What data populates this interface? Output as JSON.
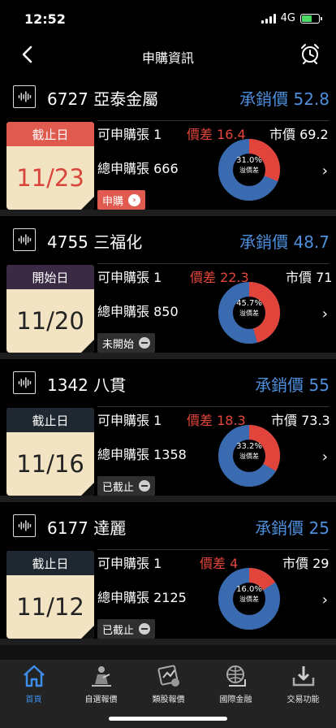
{
  "status_bar": {
    "time": "12:52",
    "network": "4G"
  },
  "nav": {
    "title": "申購資訊"
  },
  "listings": [
    {
      "name": "6727 亞泰金屬",
      "price_label": "承銷價 52.8",
      "calendar_label": "截止日",
      "date": "11/23",
      "calendar_style": "red",
      "lots": "可申購張 1",
      "spread": "價差 16.4",
      "market": "市價 69.2",
      "total": "總申購張 666",
      "status": "申購",
      "status_style": "apply",
      "donut_pct": "31.0%",
      "donut_sub": "溢價差",
      "donut_value": 0.31
    },
    {
      "name": "4755 三福化",
      "price_label": "承銷價 48.7",
      "calendar_label": "開始日",
      "date": "11/20",
      "calendar_style": "purple",
      "lots": "可申購張 1",
      "spread": "價差 22.3",
      "market": "市價 71",
      "total": "總申購張 850",
      "status": "未開始",
      "status_style": "muted",
      "donut_pct": "45.7%",
      "donut_sub": "溢價差",
      "donut_value": 0.457
    },
    {
      "name": "1342 八貫",
      "price_label": "承銷價 55",
      "calendar_label": "截止日",
      "date": "11/16",
      "calendar_style": "dark",
      "lots": "可申購張 1",
      "spread": "價差 18.3",
      "market": "市價 73.3",
      "total": "總申購張 1358",
      "status": "已截止",
      "status_style": "muted",
      "donut_pct": "33.2%",
      "donut_sub": "溢價差",
      "donut_value": 0.332
    },
    {
      "name": "6177 達麗",
      "price_label": "承銷價 25",
      "calendar_label": "截止日",
      "date": "11/12",
      "calendar_style": "dark",
      "lots": "可申購張 1",
      "spread": "價差 4",
      "market": "市價 29",
      "total": "總申購張 2125",
      "status": "已截止",
      "status_style": "muted",
      "donut_pct": "16.0%",
      "donut_sub": "溢價差",
      "donut_value": 0.16
    }
  ],
  "tabs": [
    {
      "label": "首頁",
      "icon": "home-icon",
      "active": true
    },
    {
      "label": "自選報價",
      "icon": "watchlist-icon",
      "active": false
    },
    {
      "label": "類股報價",
      "icon": "sector-icon",
      "active": false
    },
    {
      "label": "國際金融",
      "icon": "globe-icon",
      "active": false
    },
    {
      "label": "交易功能",
      "icon": "trade-icon",
      "active": false
    }
  ],
  "colors": {
    "accent_blue": "#3d8ee8",
    "price_blue": "#4d8fdc",
    "red": "#e5463b",
    "donut_blue": "#3a6bb0",
    "donut_red": "#e0443a"
  }
}
